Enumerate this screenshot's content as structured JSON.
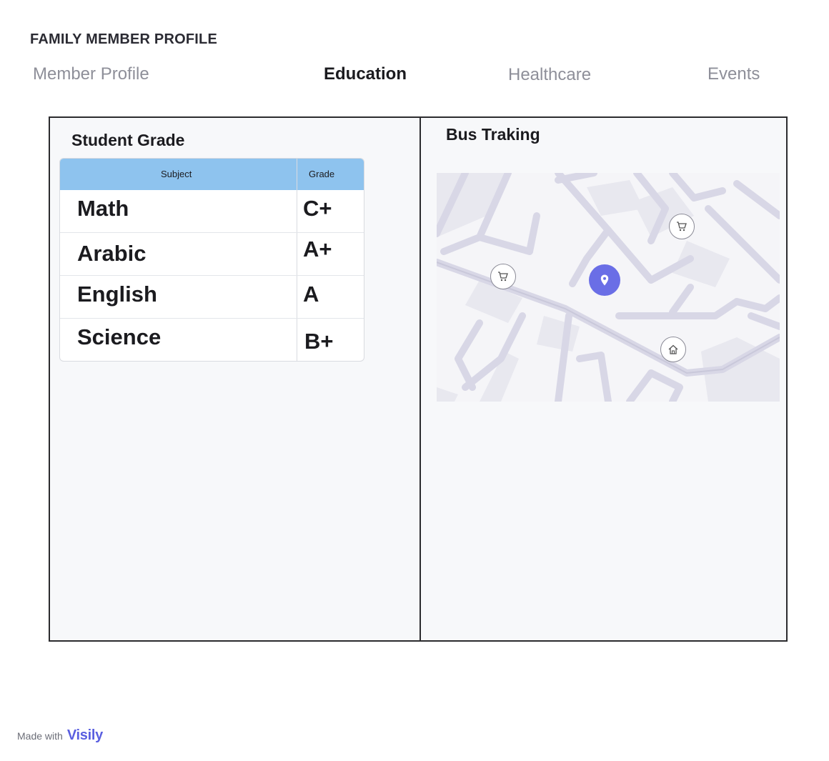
{
  "page": {
    "title": "FAMILY MEMBER PROFILE"
  },
  "tabs": [
    {
      "label": "Member Profile",
      "active": false
    },
    {
      "label": "Education",
      "active": true
    },
    {
      "label": "Healthcare",
      "active": false
    },
    {
      "label": "Events",
      "active": false
    }
  ],
  "grades": {
    "heading": "Student Grade",
    "columns": {
      "subject": "Subject",
      "grade": "Grade"
    },
    "header_color": "#8ec3ee",
    "rows": [
      {
        "subject": "Math",
        "grade": "C+"
      },
      {
        "subject": "Arabic",
        "grade": "A+"
      },
      {
        "subject": "English",
        "grade": "A"
      },
      {
        "subject": "Science",
        "grade": "B+"
      }
    ]
  },
  "bus": {
    "heading": "Bus Traking",
    "markers": [
      {
        "icon": "shopping-cart-icon"
      },
      {
        "icon": "shopping-cart-icon"
      },
      {
        "icon": "map-pin-icon",
        "color": "#6a6ee6"
      },
      {
        "icon": "home-icon"
      }
    ]
  },
  "footer": {
    "made_with": "Made with",
    "brand": "Visily",
    "brand_color": "#5a5fe0"
  }
}
